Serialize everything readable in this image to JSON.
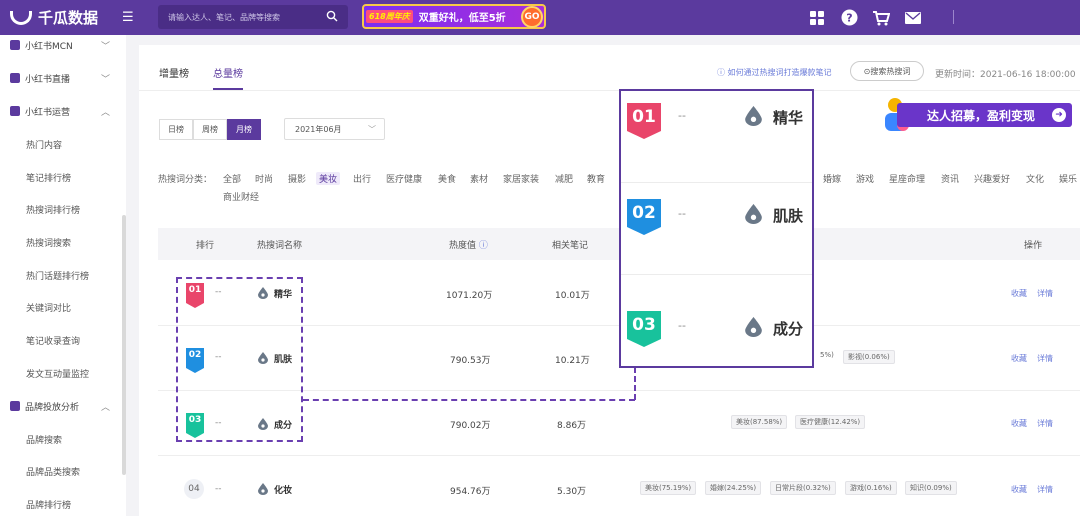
{
  "topbar": {
    "brand": "千瓜数据",
    "search_placeholder": "请输入达人、笔记、品牌等搜索",
    "banner": {
      "tag": "618周年庆",
      "text": "双重好礼，低至5折",
      "go": "GO"
    }
  },
  "sidebar": {
    "items": [
      {
        "label": "小红书MCN",
        "chevron": "﹀"
      },
      {
        "label": "小红书直播",
        "chevron": "﹀"
      },
      {
        "label": "小红书运营",
        "chevron": "︿"
      },
      {
        "label": "品牌投放分析",
        "chevron": "︿"
      }
    ],
    "sub_items": [
      "热门内容",
      "笔记排行榜",
      "热搜词排行榜",
      "热搜词搜索",
      "热门话题排行榜",
      "关键词对比",
      "笔记收录查询",
      "发文互动量监控"
    ],
    "brand_sub_items": [
      "品牌搜索",
      "品牌品类搜索",
      "品牌排行榜"
    ]
  },
  "tabs": [
    "增量榜",
    "总量榜"
  ],
  "help_link": "如何通过热搜词打造爆款笔记",
  "hot_search_button": "搜索热搜词",
  "update_time": "更新时间：2021-06-16 18:00:00",
  "period_buttons": [
    "日榜",
    "周榜",
    "月榜"
  ],
  "month_value": "2021年06月",
  "categories": {
    "label": "热搜词分类：",
    "items": [
      "全部",
      "时尚",
      "摄影",
      "美妆",
      "出行",
      "医疗健康",
      "美食",
      "素材",
      "家居家装",
      "减肥",
      "教育",
      "婚嫁",
      "游戏",
      "星座命理",
      "资讯",
      "兴趣爱好",
      "文化",
      "娱乐",
      "商业财经"
    ]
  },
  "table": {
    "headers": [
      "排行",
      "热搜词名称",
      "热度值",
      "相关笔记",
      "操作"
    ],
    "rows": [
      {
        "rank": "01",
        "change": "--",
        "keyword": "精华",
        "heat": "1071.20万",
        "notes": "10.01万",
        "tags": []
      },
      {
        "rank": "02",
        "change": "--",
        "keyword": "肌肤",
        "heat": "790.53万",
        "notes": "10.21万",
        "tags": [
          "5%)",
          "影视(0.06%)"
        ]
      },
      {
        "rank": "03",
        "change": "--",
        "keyword": "成分",
        "heat": "790.02万",
        "notes": "8.86万",
        "tags": [
          "美妆(87.58%)",
          "医疗健康(12.42%)"
        ]
      },
      {
        "rank": "04",
        "change": "--",
        "keyword": "化妆",
        "heat": "954.76万",
        "notes": "5.30万",
        "tags": [
          "美妆(75.19%)",
          "婚嫁(24.25%)",
          "日常片段(0.32%)",
          "游戏(0.16%)",
          "知识(0.09%)"
        ]
      }
    ],
    "ops": [
      "收藏",
      "详情"
    ]
  },
  "recruit_banner": "达人招募，盈利变现",
  "zoom": {
    "rows": [
      {
        "rank": "01",
        "change": "--",
        "keyword": "精华"
      },
      {
        "rank": "02",
        "change": "--",
        "keyword": "肌肤"
      },
      {
        "rank": "03",
        "change": "--",
        "keyword": "成分"
      }
    ]
  },
  "colors": {
    "brand": "#5b3a9e",
    "rank1": "#e9456a",
    "rank2": "#1f8fe0",
    "rank3": "#18c29c",
    "link": "#6a7bd8"
  }
}
